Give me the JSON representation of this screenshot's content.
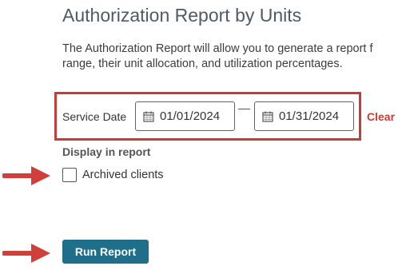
{
  "page": {
    "title": "Authorization Report by Units",
    "description_lines": [
      "The Authorization Report will allow you to generate a report f",
      "range, their unit allocation, and utilization percentages."
    ]
  },
  "filters": {
    "service_date_label": "Service Date",
    "start_date": "01/01/2024",
    "end_date": "01/31/2024",
    "clear_label": "Clear"
  },
  "display": {
    "label": "Display in report",
    "archived_clients_label": "Archived clients",
    "archived_clients_checked": false
  },
  "actions": {
    "run_report_label": "Run Report"
  },
  "colors": {
    "highlight": "#c63c36",
    "button": "#1f6f8b",
    "arrow": "#d0403a"
  },
  "icons": {
    "date_icon": "calendar-icon",
    "annotation_icon": "arrow-right-icon"
  }
}
